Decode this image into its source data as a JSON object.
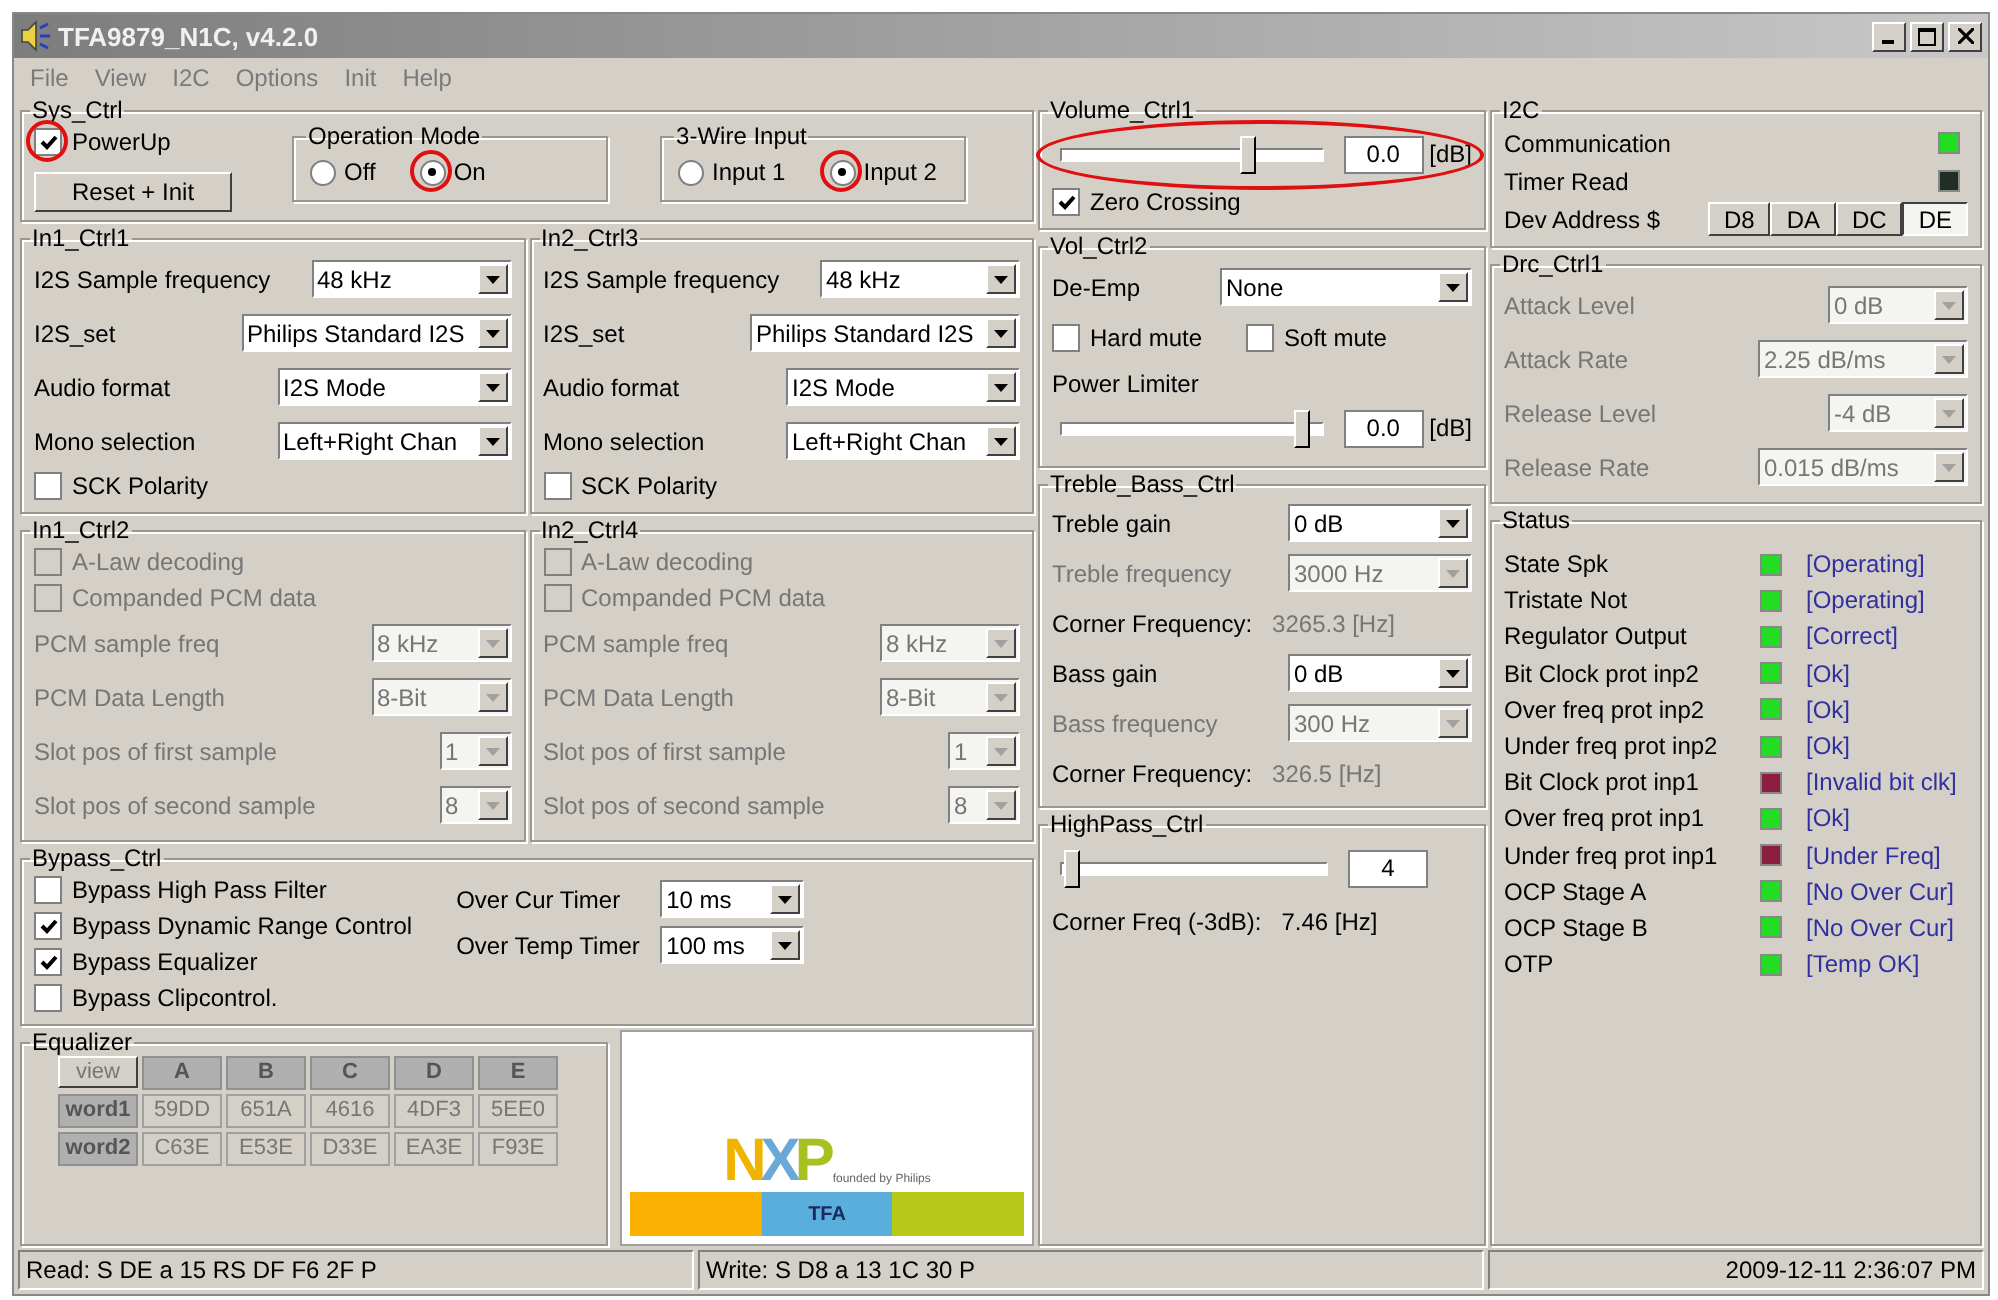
{
  "window": {
    "title": "TFA9879_N1C, v4.2.0"
  },
  "menu": [
    "File",
    "View",
    "I2C",
    "Options",
    "Init",
    "Help"
  ],
  "sys_ctrl": {
    "title": "Sys_Ctrl",
    "power_up": {
      "label": "PowerUp",
      "checked": true,
      "annotated": true
    },
    "reset_button": "Reset + Init",
    "groups": [
      {
        "title": "Operation Mode",
        "options": [
          {
            "label": "Off",
            "selected": false,
            "annotated": false
          },
          {
            "label": "On",
            "selected": true,
            "annotated": true
          }
        ]
      },
      {
        "title": "3-Wire Input",
        "options": [
          {
            "label": "Input 1",
            "selected": false,
            "annotated": false
          },
          {
            "label": "Input 2",
            "selected": true,
            "annotated": true
          }
        ]
      }
    ]
  },
  "input_panels": [
    {
      "title": "In1_Ctrl1",
      "rows": [
        {
          "label": "I2S Sample frequency",
          "value": "48 kHz"
        },
        {
          "label": "I2S_set",
          "value": "Philips Standard I2S"
        },
        {
          "label": "Audio format",
          "value": "I2S Mode"
        },
        {
          "label": "Mono selection",
          "value": "Left+Right Chan"
        }
      ],
      "checkbox": {
        "label": "SCK Polarity",
        "checked": false
      }
    },
    {
      "title": "In2_Ctrl3",
      "rows": [
        {
          "label": "I2S Sample frequency",
          "value": "48 kHz"
        },
        {
          "label": "I2S_set",
          "value": "Philips Standard I2S"
        },
        {
          "label": "Audio format",
          "value": "I2S Mode"
        },
        {
          "label": "Mono selection",
          "value": "Left+Right Chan"
        }
      ],
      "checkbox": {
        "label": "SCK Polarity",
        "checked": false
      }
    }
  ],
  "pcm_panels": [
    {
      "title": "In1_Ctrl2",
      "disabled": true,
      "checkboxes": [
        {
          "label": "A-Law decoding",
          "checked": false
        },
        {
          "label": "Companded PCM data",
          "checked": false
        }
      ],
      "rows": [
        {
          "label": "PCM sample freq",
          "value": "8 kHz"
        },
        {
          "label": "PCM Data Length",
          "value": "8-Bit"
        },
        {
          "label": "Slot pos of first sample",
          "value": "1"
        },
        {
          "label": "Slot pos of second sample",
          "value": "8"
        }
      ]
    },
    {
      "title": "In2_Ctrl4",
      "disabled": true,
      "checkboxes": [
        {
          "label": "A-Law decoding",
          "checked": false
        },
        {
          "label": "Companded PCM data",
          "checked": false
        }
      ],
      "rows": [
        {
          "label": "PCM sample freq",
          "value": "8 kHz"
        },
        {
          "label": "PCM Data Length",
          "value": "8-Bit"
        },
        {
          "label": "Slot pos of first sample",
          "value": "1"
        },
        {
          "label": "Slot pos of second sample",
          "value": "8"
        }
      ]
    }
  ],
  "bypass": {
    "title": "Bypass_Ctrl",
    "checkboxes": [
      {
        "label": "Bypass High Pass Filter",
        "checked": false
      },
      {
        "label": "Bypass Dynamic Range Control",
        "checked": true
      },
      {
        "label": "Bypass Equalizer",
        "checked": true
      },
      {
        "label": "Bypass Clipcontrol.",
        "checked": false
      }
    ],
    "timers": [
      {
        "label": "Over Cur Timer",
        "value": "10 ms"
      },
      {
        "label": "Over Temp Timer",
        "value": "100 ms"
      }
    ]
  },
  "equalizer": {
    "title": "Equalizer",
    "disabled": true,
    "view_button": "view",
    "columns": [
      "A",
      "B",
      "C",
      "D",
      "E"
    ],
    "rows": [
      {
        "label": "word1",
        "values": [
          "59DD",
          "651A",
          "4616",
          "4DF3",
          "5EE0"
        ]
      },
      {
        "label": "word2",
        "values": [
          "C63E",
          "E53E",
          "D33E",
          "EA3E",
          "F93E"
        ]
      }
    ]
  },
  "logo": {
    "wordmark": "NXP",
    "tagline": "founded by Philips",
    "banner": "TFA"
  },
  "volume": {
    "title": "Volume_Ctrl1",
    "level": 0.74,
    "value": "0.0",
    "unit": "[dB]",
    "annotated": true,
    "zero_crossing": {
      "label": "Zero Crossing",
      "checked": true
    }
  },
  "vol_ctrl2": {
    "title": "Vol_Ctrl2",
    "de_emp": {
      "label": "De-Emp",
      "value": "None"
    },
    "checkboxes": [
      {
        "label": "Hard mute",
        "checked": false
      },
      {
        "label": "Soft mute",
        "checked": false
      }
    ],
    "power_limiter": {
      "label": "Power Limiter",
      "level": 0.96,
      "value": "0.0",
      "unit": "[dB]"
    }
  },
  "treble_bass": {
    "title": "Treble_Bass_Ctrl",
    "rows": [
      {
        "kind": "select",
        "label": "Treble gain",
        "value": "0 dB",
        "disabled": false
      },
      {
        "kind": "select",
        "label": "Treble frequency",
        "value": "3000 Hz",
        "disabled": true
      },
      {
        "kind": "reading",
        "label": "Corner Frequency:",
        "value": "3265.3 [Hz]",
        "disabled": true
      },
      {
        "kind": "select",
        "label": "Bass gain",
        "value": "0 dB",
        "disabled": false
      },
      {
        "kind": "select",
        "label": "Bass frequency",
        "value": "300 Hz",
        "disabled": true
      },
      {
        "kind": "reading",
        "label": "Corner Frequency:",
        "value": "326.5 [Hz]",
        "disabled": true
      }
    ]
  },
  "highpass": {
    "title": "HighPass_Ctrl",
    "level": 0.02,
    "value": "4",
    "reading_label": "Corner Freq (-3dB):",
    "reading_value": "7.46 [Hz]"
  },
  "i2c": {
    "title": "I2C",
    "indicators": [
      {
        "label": "Communication",
        "color": "#22dd22"
      },
      {
        "label": "Timer Read",
        "color": "#1f2f25"
      }
    ],
    "address_label": "Dev Address $",
    "addresses": [
      {
        "label": "D8",
        "selected": false
      },
      {
        "label": "DA",
        "selected": false
      },
      {
        "label": "DC",
        "selected": false
      },
      {
        "label": "DE",
        "selected": true
      }
    ]
  },
  "drc": {
    "title": "Drc_Ctrl1",
    "disabled": true,
    "rows": [
      {
        "label": "Attack Level",
        "value": "0 dB"
      },
      {
        "label": "Attack Rate",
        "value": "2.25 dB/ms"
      },
      {
        "label": "Release Level",
        "value": "-4 dB"
      },
      {
        "label": "Release Rate",
        "value": "0.015 dB/ms"
      }
    ]
  },
  "status": {
    "title": "Status",
    "rows": [
      {
        "label": "State Spk",
        "color": "#22dd22",
        "text": "[Operating]"
      },
      {
        "label": "Tristate Not",
        "color": "#22dd22",
        "text": "[Operating]"
      },
      {
        "label": "Regulator Output",
        "color": "#22dd22",
        "text": "[Correct]"
      },
      {
        "label": "Bit Clock prot inp2",
        "color": "#22dd22",
        "text": "[Ok]"
      },
      {
        "label": "Over freq prot inp2",
        "color": "#22dd22",
        "text": "[Ok]"
      },
      {
        "label": "Under freq prot inp2",
        "color": "#22dd22",
        "text": "[Ok]"
      },
      {
        "label": "Bit Clock prot inp1",
        "color": "#8b1e3f",
        "text": "[Invalid bit clk]"
      },
      {
        "label": "Over freq prot inp1",
        "color": "#22dd22",
        "text": "[Ok]"
      },
      {
        "label": "Under freq prot inp1",
        "color": "#8b1e3f",
        "text": "[Under Freq]"
      },
      {
        "label": "OCP Stage A",
        "color": "#22dd22",
        "text": "[No Over Cur]"
      },
      {
        "label": "OCP Stage B",
        "color": "#22dd22",
        "text": "[No Over Cur]"
      },
      {
        "label": "OTP",
        "color": "#22dd22",
        "text": "[Temp OK]"
      }
    ]
  },
  "status_bar": [
    "Read: S DE a 15 RS DF F6 2F P",
    "Write: S D8 a 13 1C 30 P",
    "2009-12-11 2:36:07 PM"
  ]
}
